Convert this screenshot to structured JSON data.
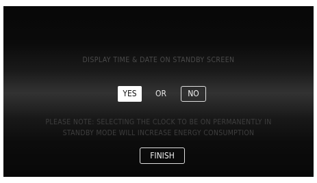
{
  "prompt": {
    "title": "DISPLAY TIME & DATE ON STANDBY SCREEN",
    "yes_label": "YES",
    "or_label": "OR",
    "no_label": "NO",
    "note_line1": "PLEASE NOTE: SELECTING THE CLOCK TO BE ON PERMANENTLY IN",
    "note_line2": "STANDBY MODE WILL INCREASE ENERGY CONSUMPTION",
    "finish_label": "FINISH",
    "selected": "YES"
  },
  "colors": {
    "background": "#0a0a0a",
    "highlight": "#ffffff",
    "dim_text": "#4a4a4a"
  }
}
